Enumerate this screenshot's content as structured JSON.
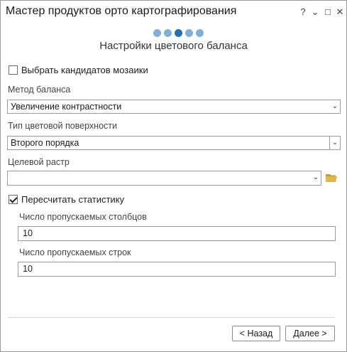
{
  "window": {
    "title": "Мастер продуктов орто картографирования",
    "help": "?",
    "menu": "⌄",
    "restore": "□",
    "close": "✕"
  },
  "wizard": {
    "total_steps": 5,
    "current_step": 3,
    "page_title": "Настройки цветового баланса"
  },
  "form": {
    "select_mosaic_candidates": {
      "label": "Выбрать кандидатов мозаики",
      "checked": false
    },
    "balance_method": {
      "label": "Метод баланса",
      "value": "Увеличение контрастности"
    },
    "color_surface": {
      "label": "Тип цветовой поверхности",
      "value": "Второго порядка"
    },
    "target_raster": {
      "label": "Целевой растр",
      "value": ""
    },
    "recalc_stats": {
      "label": "Пересчитать статистику",
      "checked": true
    },
    "skip_columns": {
      "label": "Число пропускаемых столбцов",
      "value": "10"
    },
    "skip_rows": {
      "label": "Число пропускаемых строк",
      "value": "10"
    }
  },
  "buttons": {
    "back": "< Назад",
    "next": "Далее >"
  },
  "colors": {
    "step_active": "#1f6fb5",
    "step_inactive": "#7fb0dc",
    "folder": "#e2b84a"
  }
}
